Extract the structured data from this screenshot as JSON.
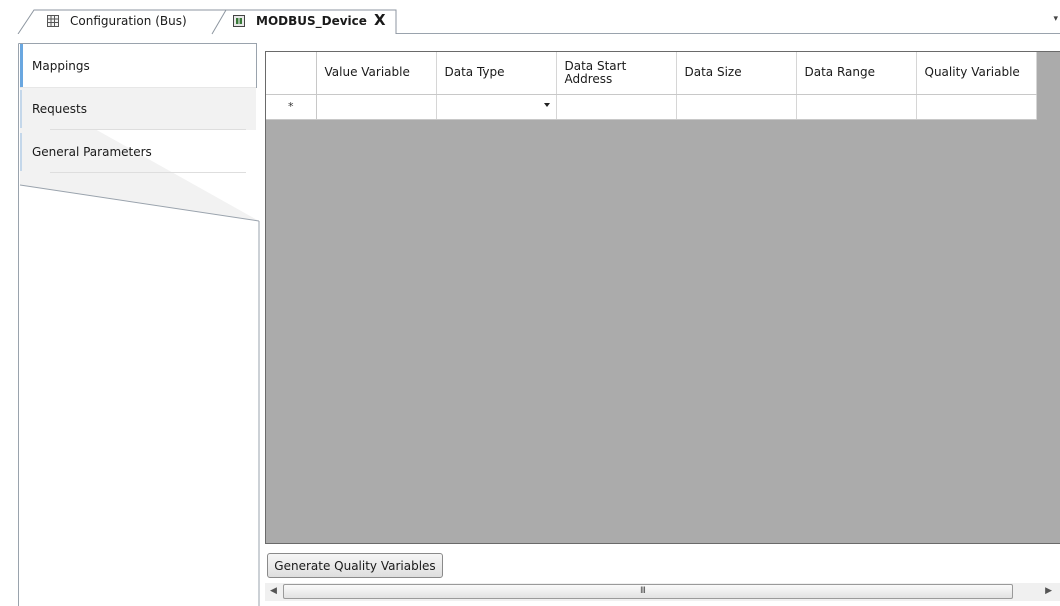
{
  "tabs": [
    {
      "label": "Configuration (Bus)",
      "icon": "grid-config-icon",
      "active": false
    },
    {
      "label": "MODBUS_Device",
      "icon": "device-icon",
      "active": true,
      "close_glyph": "X"
    }
  ],
  "left_tabs": [
    {
      "label": "Mappings",
      "active": true
    },
    {
      "label": "Requests",
      "active": false
    },
    {
      "label": "General Parameters",
      "active": false
    }
  ],
  "grid": {
    "columns": [
      "Value Variable",
      "Data Type",
      "Data Start Address",
      "Data Size",
      "Data Range",
      "Quality Variable"
    ],
    "new_row_marker": "*",
    "rows": [
      {
        "value_variable": "",
        "data_type": "",
        "data_start_address": "",
        "data_size": "",
        "data_range": "",
        "quality_variable": ""
      }
    ]
  },
  "buttons": {
    "generate_quality_variables": "Generate Quality Variables"
  },
  "scrollbar": {
    "grip": "III"
  },
  "colors": {
    "grid_background": "#ababab",
    "active_tab_accent": "#6aa7e0"
  }
}
